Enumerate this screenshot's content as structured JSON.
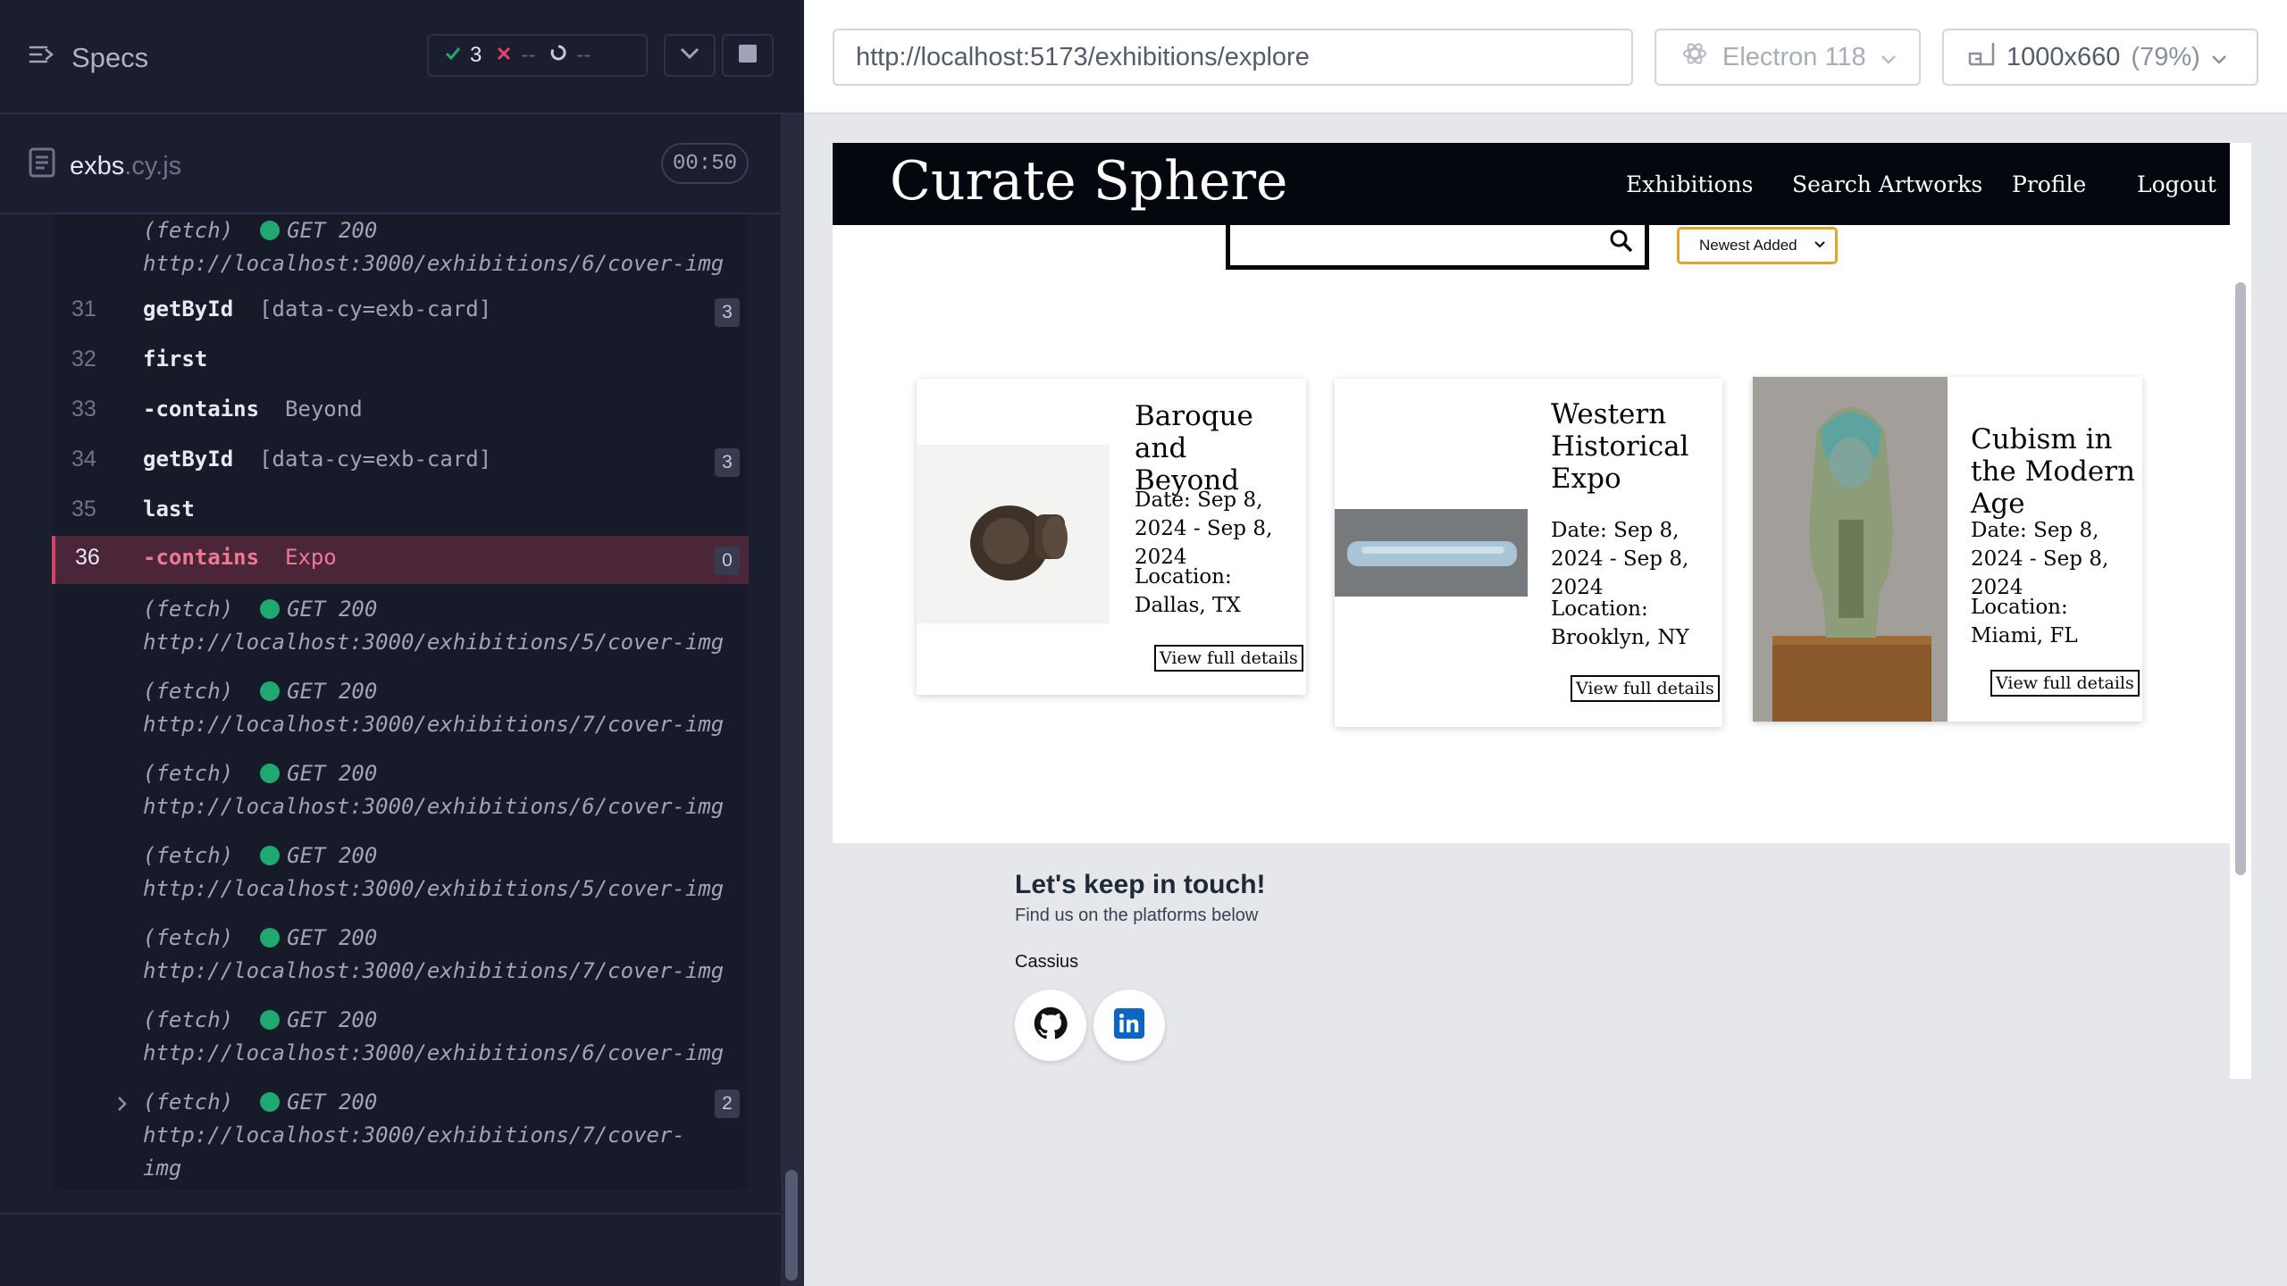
{
  "runner": {
    "specs_label": "Specs",
    "passed": "3",
    "failed": "--",
    "pending": "--",
    "file_name": "exbs",
    "file_ext": ".cy.js",
    "timer": "00:50"
  },
  "log": {
    "top_fetch": {
      "label": "(fetch)",
      "status": "GET 200",
      "url": "http://localhost:3000/exhibitions/6/cover-img"
    },
    "commands": [
      {
        "num": "31",
        "cmd": "getById",
        "arg": "[data-cy=exb-card]",
        "badge": "3"
      },
      {
        "num": "32",
        "cmd": "first",
        "arg": "",
        "badge": ""
      },
      {
        "num": "33",
        "cmd": "-contains",
        "arg": "Beyond",
        "badge": ""
      },
      {
        "num": "34",
        "cmd": "getById",
        "arg": "[data-cy=exb-card]",
        "badge": "3"
      },
      {
        "num": "35",
        "cmd": "last",
        "arg": "",
        "badge": ""
      },
      {
        "num": "36",
        "cmd": "-contains",
        "arg": "Expo",
        "badge": "0"
      }
    ],
    "fetches": [
      {
        "label": "(fetch)",
        "status": "GET 200",
        "url": "http://localhost:3000/exhibitions/5/cover-img"
      },
      {
        "label": "(fetch)",
        "status": "GET 200",
        "url": "http://localhost:3000/exhibitions/7/cover-img"
      },
      {
        "label": "(fetch)",
        "status": "GET 200",
        "url": "http://localhost:3000/exhibitions/6/cover-img"
      },
      {
        "label": "(fetch)",
        "status": "GET 200",
        "url": "http://localhost:3000/exhibitions/5/cover-img"
      },
      {
        "label": "(fetch)",
        "status": "GET 200",
        "url": "http://localhost:3000/exhibitions/7/cover-img"
      },
      {
        "label": "(fetch)",
        "status": "GET 200",
        "url": "http://localhost:3000/exhibitions/6/cover-img"
      }
    ],
    "last_fetch": {
      "label": "(fetch)",
      "status": "GET 200",
      "url1": "http://localhost:3000/exhibitions/7/cover-",
      "url2": "img",
      "badge": "2"
    }
  },
  "browser": {
    "url": "http://localhost:5173/exhibitions/explore",
    "engine": "Electron 118",
    "viewport": "1000x660",
    "zoom": "(79%)"
  },
  "app": {
    "brand": "Curate Sphere",
    "nav": [
      "Exhibitions",
      "Search Artworks",
      "Profile",
      "Logout"
    ],
    "sort_value": "Newest Added",
    "cards": [
      {
        "title": "Baroque and Beyond",
        "date": "Date: Sep 8, 2024 - Sep 8, 2024",
        "location": "Location: Dallas, TX",
        "button": "View full details"
      },
      {
        "title": "Western Historical Expo",
        "date": "Date: Sep 8, 2024 - Sep 8, 2024",
        "location": "Location: Brooklyn, NY",
        "button": "View full details"
      },
      {
        "title": "Cubism in the Modern Age",
        "date": "Date: Sep 8, 2024 - Sep 8, 2024",
        "location": "Location: Miami, FL",
        "button": "View full details"
      }
    ],
    "footer": {
      "title": "Let's keep in touch!",
      "subtitle": "Find us on the platforms below",
      "name": "Cassius"
    }
  },
  "colors": {
    "runner_bg": "#1b1e2e",
    "active_row": "#4a2638",
    "status_dot": "#1fa971",
    "sort_border": "#e3a32a",
    "nav_bg": "#05070f",
    "linkedin": "#0a66c2"
  },
  "icons": [
    "specs-icon",
    "check-icon",
    "cross-icon",
    "spinner-icon",
    "chevron-down-icon",
    "stop-icon",
    "file-icon",
    "electron-icon",
    "viewport-icon",
    "search-icon",
    "github-icon",
    "linkedin-icon"
  ]
}
